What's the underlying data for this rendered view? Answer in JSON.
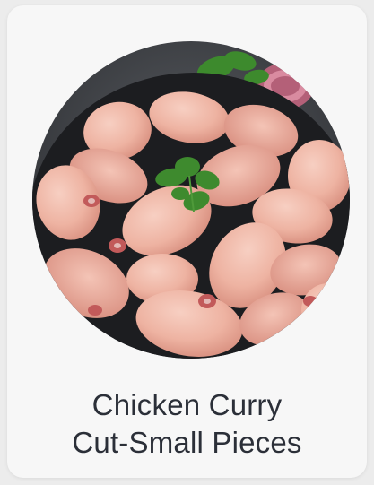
{
  "product": {
    "image_alt": "Chicken Curry Cut-Small Pieces",
    "name_line1": "Chicken Curry",
    "name_line2": "Cut-Small Pieces"
  },
  "colors": {
    "card_bg": "#f7f7f7",
    "page_bg": "#ececec",
    "title_text": "#2b2f38",
    "plate": "#1e1f22",
    "chicken": "#f0b8a8",
    "chicken_shade": "#dc9585",
    "parsley": "#3e8a2e",
    "onion": "#a8506a"
  }
}
